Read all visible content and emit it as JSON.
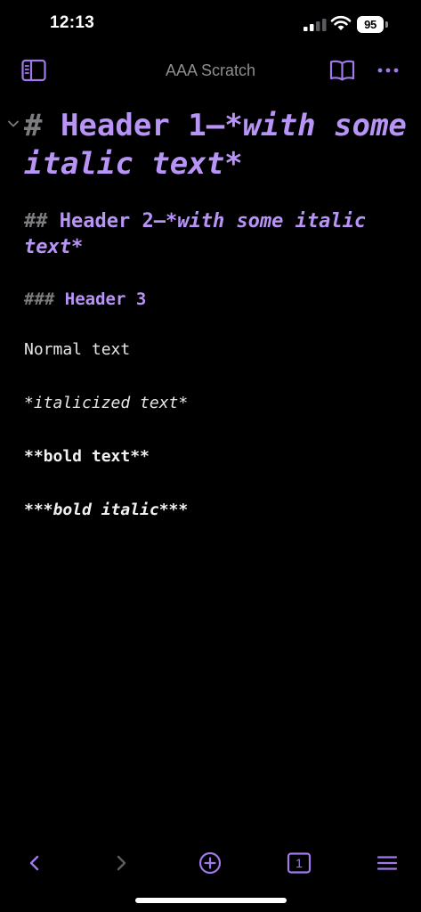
{
  "status_bar": {
    "time": "12:13",
    "battery": "95",
    "icons": [
      "signal-icon",
      "wifi-icon",
      "battery-icon"
    ]
  },
  "nav": {
    "title": "AAA Scratch",
    "icons": [
      "sidebar-icon",
      "book-icon",
      "ellipsis-icon"
    ]
  },
  "editor": {
    "h1": {
      "marker": "# ",
      "text": "Header 1—",
      "italic": "*with some italic text*"
    },
    "h2": {
      "marker": "## ",
      "text": "Header 2—",
      "italic": "*with some italic text*"
    },
    "h3": {
      "marker": "### ",
      "text": "Header 3"
    },
    "normal": "Normal text",
    "italic": "*italicized text*",
    "bold": "**bold text**",
    "bold_italic": "***bold italic***"
  },
  "toolbar": {
    "tab_count": "1",
    "icons": [
      "chevron-left-icon",
      "chevron-right-icon",
      "plus-circle-icon",
      "tabs-icon",
      "menu-icon"
    ]
  },
  "colors": {
    "accent": "#9f7aea",
    "heading": "#b794f6",
    "marker": "#7c7c80",
    "background": "#000000"
  }
}
